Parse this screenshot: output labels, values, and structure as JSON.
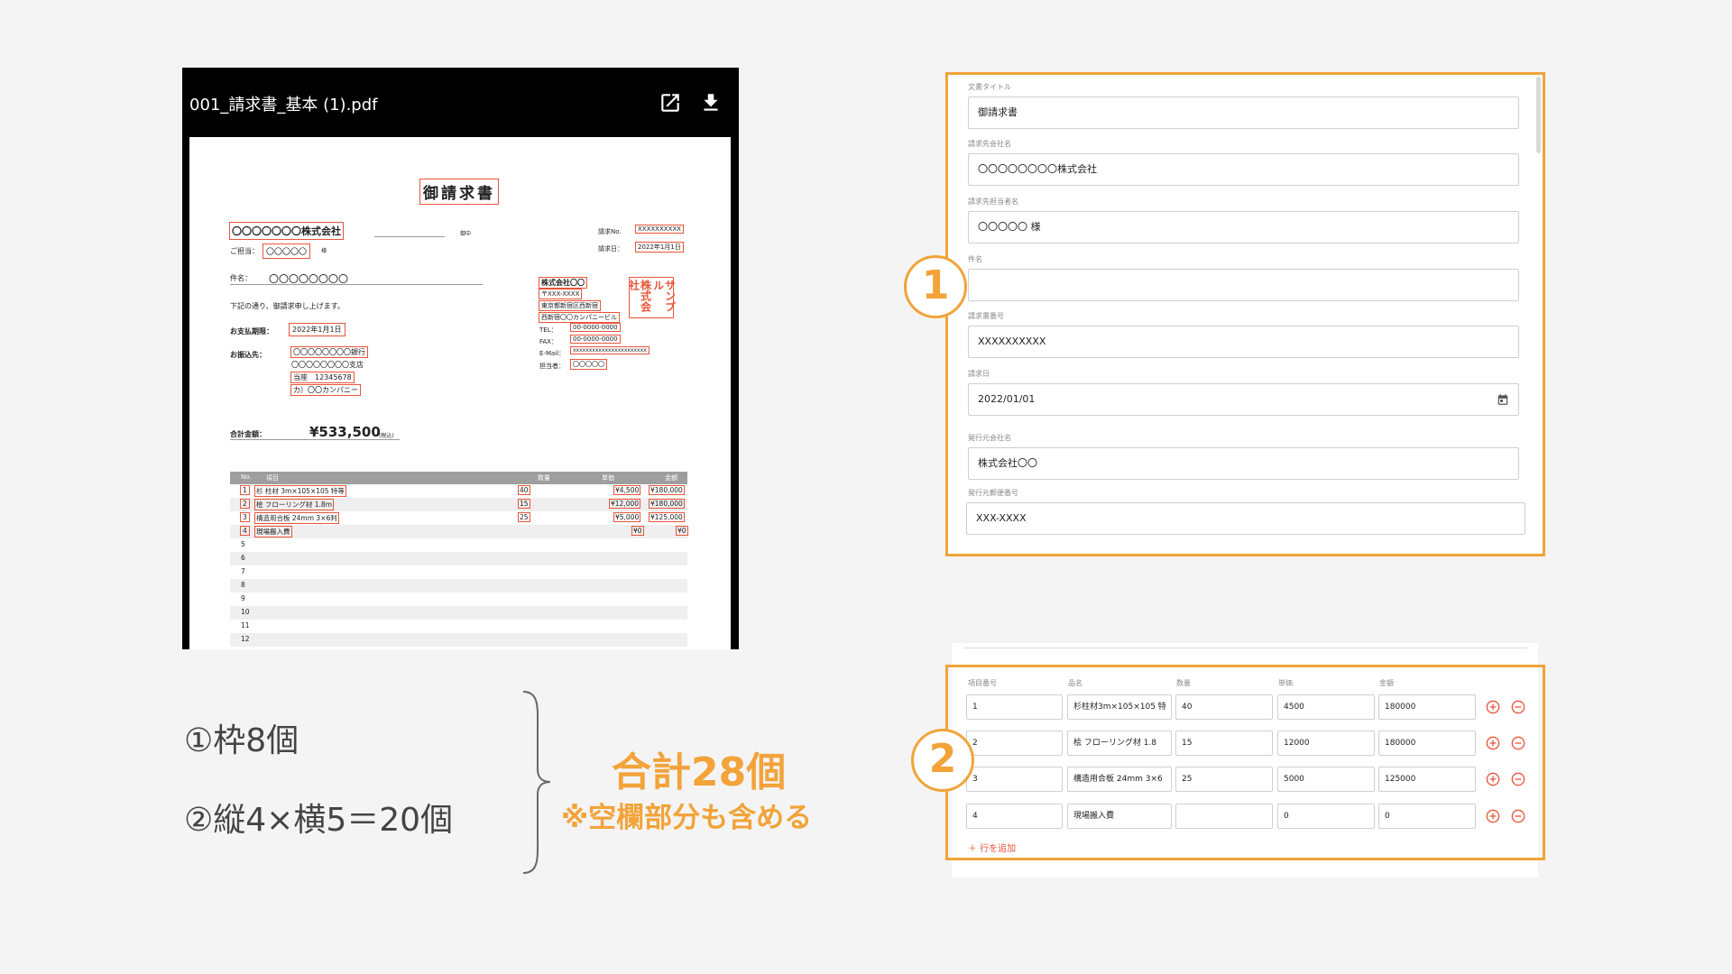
{
  "viewer": {
    "filename": "001_請求書_基本 (1).pdf",
    "open_icon": "open-in-new-icon",
    "download_icon": "download-icon"
  },
  "invoice": {
    "title": "御請求書",
    "client_company": "〇〇〇〇〇〇〇株式会社",
    "onchu": "御中",
    "contact_label": "ご担当：",
    "contact_value": "〇〇〇〇〇",
    "sama": "様",
    "subject_label": "件名：",
    "subject_value": "〇〇〇〇〇〇〇〇",
    "greeting": "下記の通り、御請求申し上げます。",
    "due_label": "お支払期限：",
    "due_value": "2022年1月1日",
    "bank_label": "お振込先：",
    "bank_lines": [
      "〇〇〇〇〇〇〇〇銀行",
      "〇〇〇〇〇〇〇〇支店",
      "当座　12345678",
      "カ）〇〇カンパニー"
    ],
    "invoice_no_label": "請求No.",
    "invoice_no_value": "XXXXXXXXXX",
    "invoice_date_label": "請求日：",
    "invoice_date_value": "2022年1月1日",
    "issuer_company": "株式会社〇〇",
    "issuer_zip": "〒XXX-XXXX",
    "issuer_addr1": "東京都新宿区西新宿",
    "issuer_addr2": "西新宿〇〇カンパニービル",
    "tel_label": "TEL：",
    "tel_value": "00-0000-0000",
    "fax_label": "FAX：",
    "fax_value": "00-0000-0000",
    "email_label": "E-Mail：",
    "email_value": "xxxxxxxxxxxxxxxxxxxxxxx",
    "staff_label": "担当者：",
    "staff_value": "〇〇〇〇〇",
    "stamp_cols": [
      "株式会社",
      "サンプル",
      "サンプル"
    ],
    "total_label": "合計金額：",
    "total_value": "¥533,500",
    "tax_note": "(税込)",
    "table_headers": [
      "No.",
      "項目",
      "数量",
      "単価",
      "金額"
    ],
    "table_rows": [
      {
        "no": "1",
        "item": "杉 柱材 3m×105×105 特等",
        "qty": "40",
        "unit": "¥4,500",
        "amount": "¥180,000"
      },
      {
        "no": "2",
        "item": "桧 フローリング材 1.8m",
        "qty": "15",
        "unit": "¥12,000",
        "amount": "¥180,000"
      },
      {
        "no": "3",
        "item": "構造用合板 24mm 3×6判",
        "qty": "25",
        "unit": "¥5,000",
        "amount": "¥125,000"
      },
      {
        "no": "4",
        "item": "現場搬入費",
        "qty": "",
        "unit": "¥0",
        "amount": "¥0"
      },
      {
        "no": "5",
        "item": "",
        "qty": "",
        "unit": "",
        "amount": ""
      },
      {
        "no": "6",
        "item": "",
        "qty": "",
        "unit": "",
        "amount": ""
      },
      {
        "no": "7",
        "item": "",
        "qty": "",
        "unit": "",
        "amount": ""
      },
      {
        "no": "8",
        "item": "",
        "qty": "",
        "unit": "",
        "amount": ""
      },
      {
        "no": "9",
        "item": "",
        "qty": "",
        "unit": "",
        "amount": ""
      },
      {
        "no": "10",
        "item": "",
        "qty": "",
        "unit": "",
        "amount": ""
      },
      {
        "no": "11",
        "item": "",
        "qty": "",
        "unit": "",
        "amount": ""
      },
      {
        "no": "12",
        "item": "",
        "qty": "",
        "unit": "",
        "amount": ""
      }
    ]
  },
  "form1": {
    "fields": [
      {
        "label": "文書タイトル",
        "value": ""
      },
      {
        "label": "請求先会社名",
        "value": ""
      },
      {
        "label": "請求先担当者名",
        "value": ""
      },
      {
        "label": "件名",
        "value": ""
      },
      {
        "label": "請求書番号",
        "value": ""
      },
      {
        "label": "請求日",
        "value": ""
      },
      {
        "label": "発行元会社名",
        "value": ""
      },
      {
        "label": "発行元郵便番号",
        "value": ""
      }
    ],
    "calendar_icon": "calendar-icon"
  },
  "form1_values": [
    "御請求書",
    "〇〇〇〇〇〇〇〇株式会社",
    "〇〇〇〇〇 様",
    "",
    "XXXXXXXXXX",
    "2022/01/01",
    "株式会社〇〇",
    "XXX-XXXX"
  ],
  "form2": {
    "headers": [
      "項目番号",
      "品名",
      "数量",
      "単価",
      "金額"
    ],
    "rows": [
      [
        "1",
        "杉柱材3m×105×105 特",
        "40",
        "4500",
        "180000"
      ],
      [
        "2",
        "桧 フローリング材 1.8",
        "15",
        "12000",
        "180000"
      ],
      [
        "3",
        "構造用合板 24mm 3×6",
        "25",
        "5000",
        "125000"
      ],
      [
        "4",
        "現場搬入費",
        "",
        "0",
        "0"
      ]
    ],
    "add_row_label": "＋ 行を追加",
    "add_icon": "add-circle-icon",
    "remove_icon": "remove-circle-icon"
  },
  "markers": {
    "one": "1",
    "two": "2"
  },
  "notes": {
    "line1": "①枠8個",
    "line2": "②縦4×横5＝20個",
    "total": "合計28個",
    "note": "※空欄部分も含める"
  },
  "colors": {
    "accent": "#f2a33a",
    "highlight": "#e8553a",
    "viewer_bg": "#000000"
  }
}
